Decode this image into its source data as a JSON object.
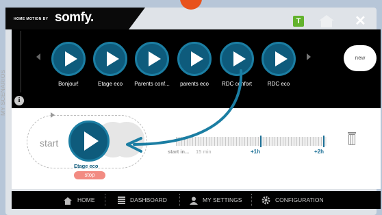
{
  "header": {
    "tagline": "HOME MOTION BY",
    "brand": "somfy.",
    "t_button": "T",
    "close": "✕"
  },
  "scenarios": {
    "side_label": "MY SCENARIOS",
    "info": "i",
    "items": [
      {
        "label": "Bonjour!"
      },
      {
        "label": "Etage eco"
      },
      {
        "label": "Parents conf..."
      },
      {
        "label": "parents eco"
      },
      {
        "label": "RDC confort"
      },
      {
        "label": "RDC eco"
      }
    ],
    "new_label": "new"
  },
  "workspace": {
    "start_label": "start",
    "scenario_label": "Etage eco",
    "stop_label": "stop",
    "timeline": {
      "start_label": "start in...",
      "min_label": "15 min",
      "h1_label": "+1h",
      "h2_label": "+2h"
    }
  },
  "footer": {
    "items": [
      {
        "label": "HOME",
        "icon": "house-icon"
      },
      {
        "label": "DASHBOARD",
        "icon": "dashboard-icon"
      },
      {
        "label": "MY SETTINGS",
        "icon": "person-icon"
      },
      {
        "label": "CONFIGURATION",
        "icon": "gear-icon"
      }
    ]
  },
  "colors": {
    "accent": "#e8521c",
    "play": "#0e5b7c",
    "t_badge": "#62b22d",
    "stop": "#f28b82"
  }
}
